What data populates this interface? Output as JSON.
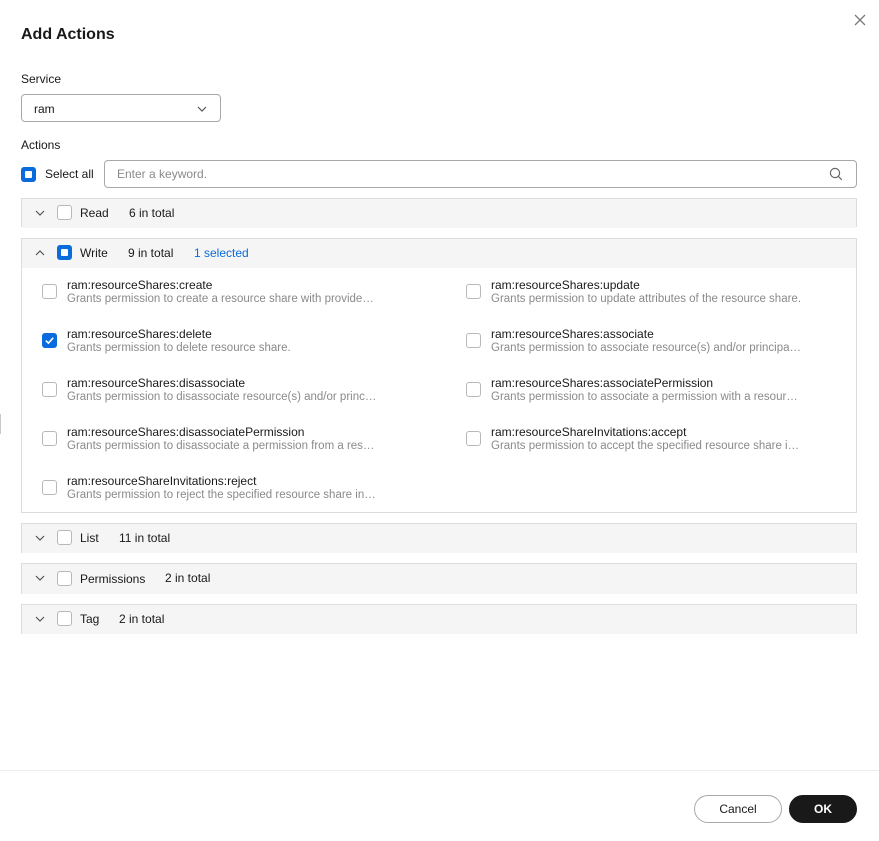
{
  "dialog": {
    "title": "Add Actions"
  },
  "service": {
    "label": "Service",
    "value": "ram"
  },
  "actions": {
    "label": "Actions",
    "select_all_label": "Select all",
    "search_placeholder": "Enter a keyword."
  },
  "groups": {
    "read": {
      "name": "Read",
      "count": "6 in total"
    },
    "write": {
      "name": "Write",
      "count": "9 in total",
      "selected": "1 selected",
      "items": [
        {
          "name": "ram:resourceShares:create",
          "desc": "Grants permission to create a resource share with provided resource(s) and/or principal(s)."
        },
        {
          "name": "ram:resourceShares:update",
          "desc": "Grants permission to update attributes of the resource share."
        },
        {
          "name": "ram:resourceShares:delete",
          "desc": "Grants permission to delete resource share."
        },
        {
          "name": "ram:resourceShares:associate",
          "desc": "Grants permission to associate resource(s) and/or principal(s) with a resource share."
        },
        {
          "name": "ram:resourceShares:disassociate",
          "desc": "Grants permission to disassociate resource(s) and/or principal(s) from a resource share."
        },
        {
          "name": "ram:resourceShares:associatePermission",
          "desc": "Grants permission to associate a permission with a resource share."
        },
        {
          "name": "ram:resourceShares:disassociatePermission",
          "desc": "Grants permission to disassociate a permission from a resource share."
        },
        {
          "name": "ram:resourceShareInvitations:accept",
          "desc": "Grants permission to accept the specified resource share invitation."
        },
        {
          "name": "ram:resourceShareInvitations:reject",
          "desc": "Grants permission to reject the specified resource share invitation."
        }
      ]
    },
    "list": {
      "name": "List",
      "count": "11 in total"
    },
    "permissions": {
      "name": "Permissions",
      "count": "2 in total"
    },
    "tag": {
      "name": "Tag",
      "count": "2 in total"
    }
  },
  "footer": {
    "cancel_label": "Cancel",
    "ok_label": "OK"
  },
  "colors": {
    "accent": "#0a6bdc",
    "primary_button": "#191919",
    "header_bg": "#f5f5f5"
  }
}
